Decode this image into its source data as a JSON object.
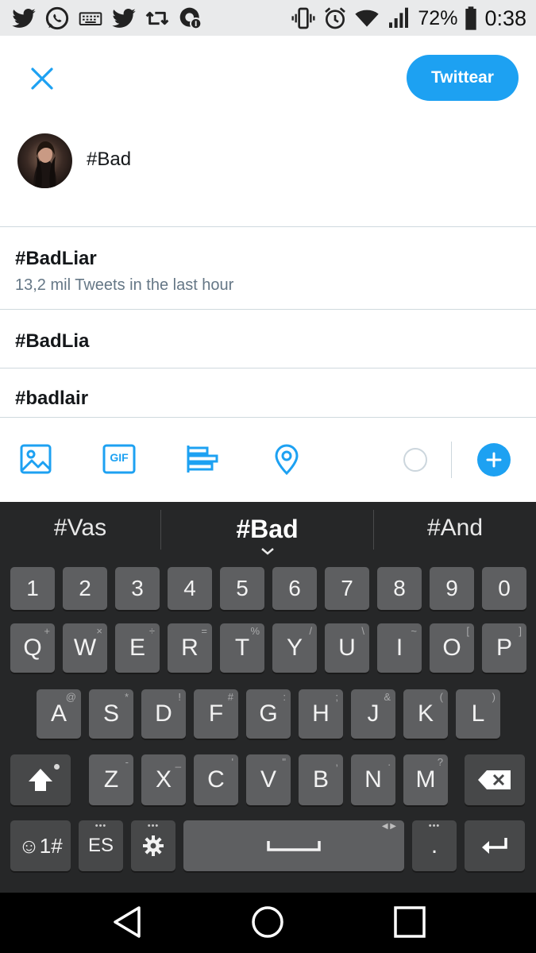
{
  "status_bar": {
    "left_icons": [
      "twitter-icon",
      "whatsapp-icon",
      "keyboard-icon",
      "twitter-icon",
      "retweet-icon",
      "notification-icon"
    ],
    "right_icons": [
      "vibrate-icon",
      "alarm-icon",
      "wifi-icon",
      "signal-icon",
      "battery-icon"
    ],
    "battery": "72%",
    "time": "0:38"
  },
  "compose": {
    "tweet_button_label": "Twittear",
    "text": "#Bad"
  },
  "suggestions": [
    {
      "tag": "#BadLiar",
      "subtitle": "13,2 mil Tweets in the last hour"
    },
    {
      "tag": "#BadLia"
    },
    {
      "tag": "#badlair"
    }
  ],
  "toolbar": {
    "icons": [
      "image-icon",
      "gif-icon",
      "poll-icon",
      "location-icon"
    ],
    "gif_label": "GIF",
    "accent": "#1da1f2"
  },
  "keyboard": {
    "suggestions": [
      "#Vas",
      "#Bad",
      "#And"
    ],
    "numbers": [
      "1",
      "2",
      "3",
      "4",
      "5",
      "6",
      "7",
      "8",
      "9",
      "0"
    ],
    "row1": [
      {
        "k": "Q",
        "h": "+"
      },
      {
        "k": "W",
        "h": "×"
      },
      {
        "k": "E",
        "h": "÷"
      },
      {
        "k": "R",
        "h": "="
      },
      {
        "k": "T",
        "h": "%"
      },
      {
        "k": "Y",
        "h": "/"
      },
      {
        "k": "U",
        "h": "\\"
      },
      {
        "k": "I",
        "h": "~"
      },
      {
        "k": "O",
        "h": "["
      },
      {
        "k": "P",
        "h": "]"
      }
    ],
    "row2": [
      {
        "k": "A",
        "h": "@"
      },
      {
        "k": "S",
        "h": "*"
      },
      {
        "k": "D",
        "h": "!"
      },
      {
        "k": "F",
        "h": "#"
      },
      {
        "k": "G",
        "h": ":"
      },
      {
        "k": "H",
        "h": ";"
      },
      {
        "k": "J",
        "h": "&"
      },
      {
        "k": "K",
        "h": "("
      },
      {
        "k": "L",
        "h": ")"
      }
    ],
    "row3": [
      {
        "k": "Z",
        "h": "-"
      },
      {
        "k": "X",
        "h": "_"
      },
      {
        "k": "C",
        "h": "'"
      },
      {
        "k": "V",
        "h": "\""
      },
      {
        "k": "B",
        "h": ","
      },
      {
        "k": "N",
        "h": "."
      },
      {
        "k": "M",
        "h": "?"
      }
    ],
    "symbols_label": "☺1#",
    "language_label": "ES",
    "period_label": "."
  }
}
